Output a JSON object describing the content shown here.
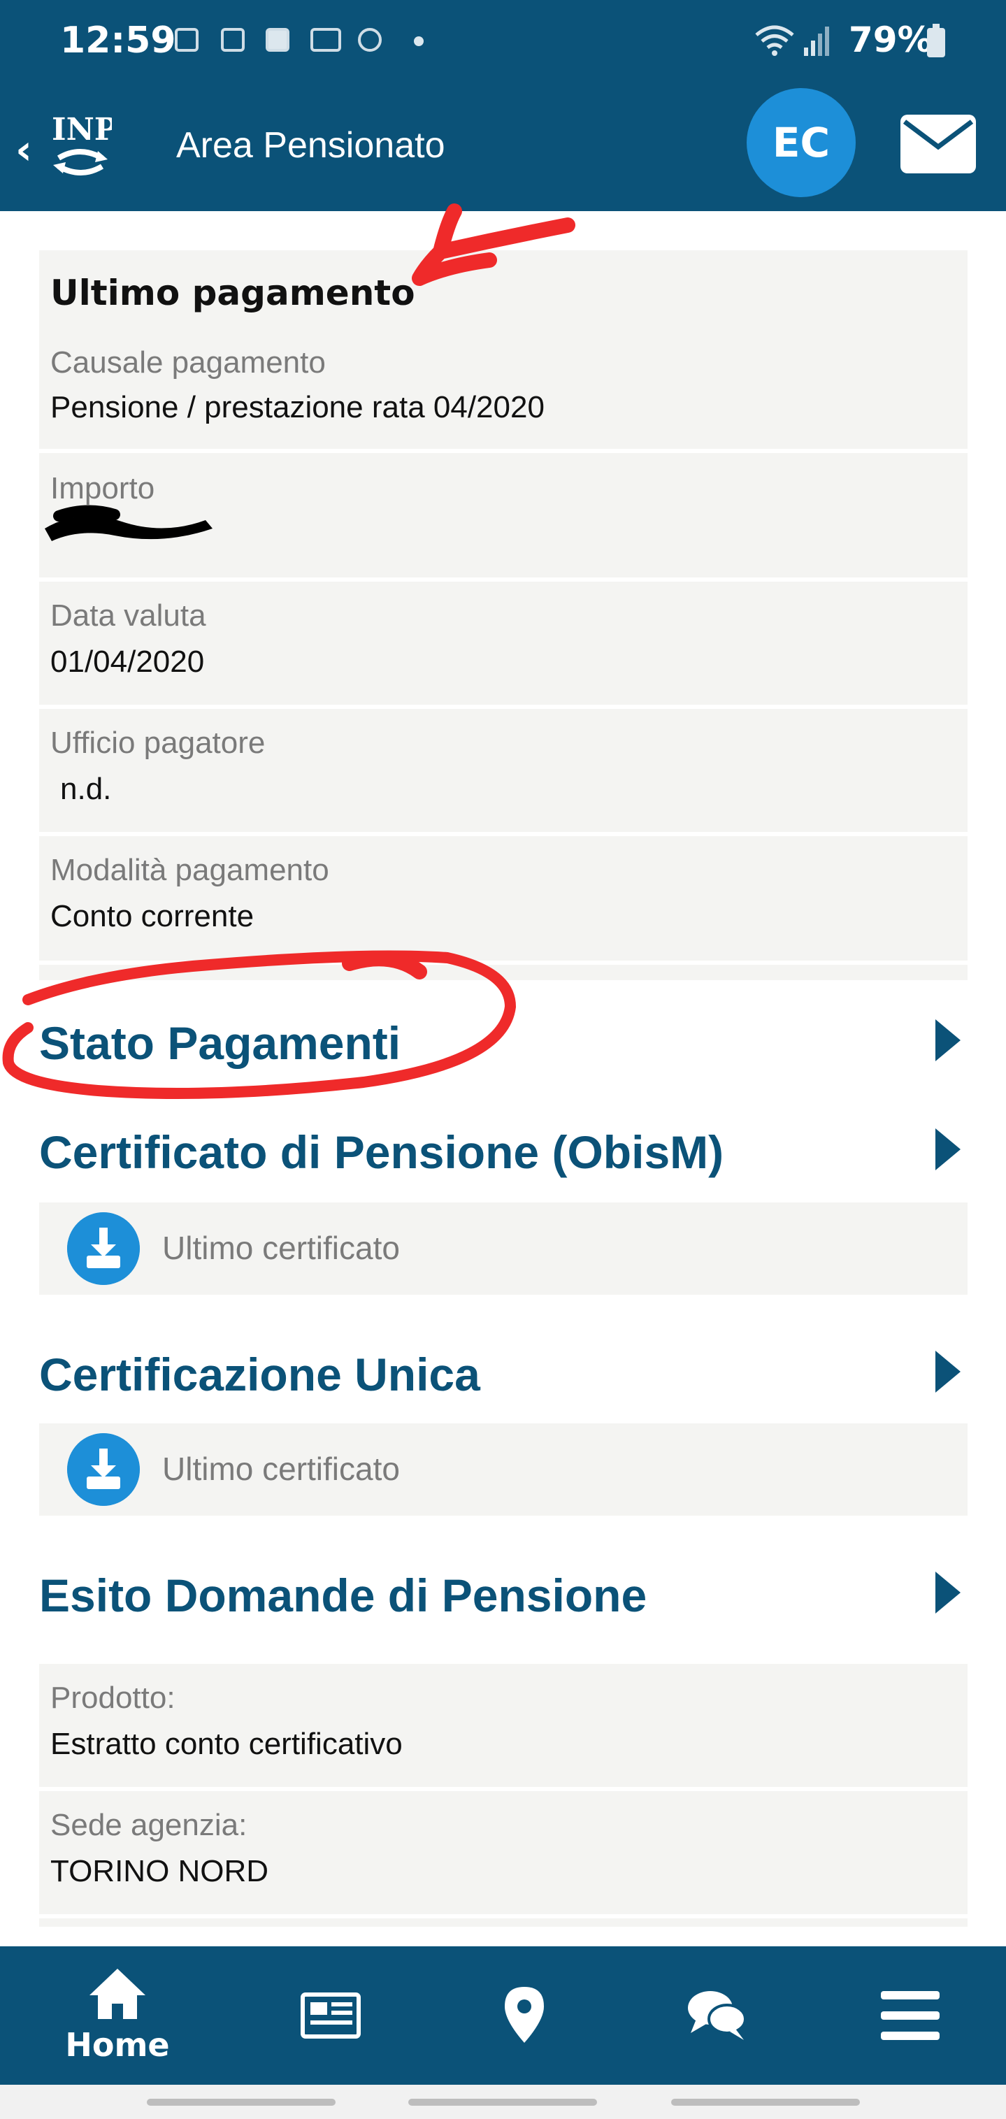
{
  "status_bar": {
    "time": "12:59",
    "battery": "79%"
  },
  "app_bar": {
    "back_icon": "chevron-left-icon",
    "logo_text": "INPS",
    "title": "Area Pensionato",
    "avatar_initials": "EC",
    "mail_icon": "mail-icon",
    "colors": {
      "primary": "#0b5278",
      "accent": "#1d8fd8"
    }
  },
  "last_payment": {
    "title": "Ultimo pagamento",
    "fields": [
      {
        "label": "Causale pagamento",
        "value": "Pensione / prestazione rata 04/2020"
      },
      {
        "label": "Importo",
        "value": ""
      },
      {
        "label": "Data valuta",
        "value": "01/04/2020"
      },
      {
        "label": "Ufficio pagatore",
        "value": "n.d."
      },
      {
        "label": "Modalità pagamento",
        "value": "Conto corrente"
      }
    ]
  },
  "sections": {
    "stato_pagamenti": {
      "title": "Stato Pagamenti"
    },
    "certificato_pensione": {
      "title": "Certificato di Pensione (ObisM)",
      "download_label": "Ultimo certificato"
    },
    "certificazione_unica": {
      "title": "Certificazione Unica",
      "download_label": "Ultimo certificato"
    },
    "esito_domande": {
      "title": "Esito Domande di Pensione",
      "fields": [
        {
          "label": "Prodotto:",
          "value": "Estratto conto certificativo"
        },
        {
          "label": "Sede agenzia:",
          "value": "TORINO NORD"
        }
      ]
    }
  },
  "bottom_nav": {
    "items": [
      {
        "icon": "home-icon",
        "label": "Home"
      },
      {
        "icon": "news-icon",
        "label": ""
      },
      {
        "icon": "location-pin-icon",
        "label": ""
      },
      {
        "icon": "chat-icon",
        "label": ""
      },
      {
        "icon": "menu-icon",
        "label": ""
      }
    ]
  }
}
